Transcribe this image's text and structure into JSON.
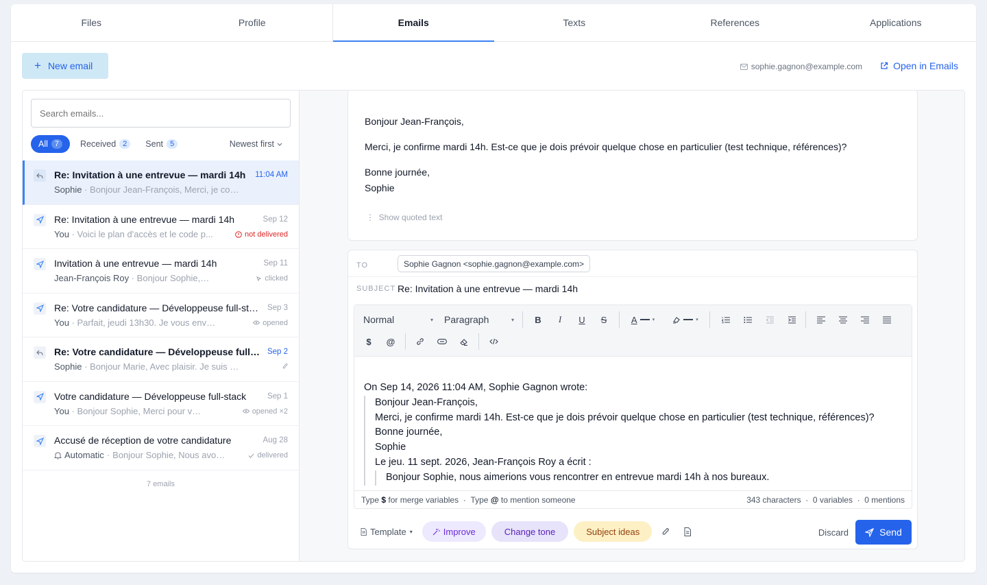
{
  "tabs": [
    "Files",
    "Profile",
    "Emails",
    "Texts",
    "References",
    "Applications"
  ],
  "toolbar": {
    "new_email": "New email",
    "account": "sophie.gagnon@example.com",
    "open_in": "Open in Emails"
  },
  "search": {
    "placeholder": "Search emails..."
  },
  "filters": {
    "all": "All",
    "all_count": "7",
    "received": "Received",
    "received_count": "2",
    "sent": "Sent",
    "sent_count": "5",
    "sort": "Newest first"
  },
  "emails": [
    {
      "subject": "Re: Invitation à une entrevue — mardi 14h",
      "date": "11:04 AM",
      "who": "Sophie",
      "preview": "Bonjour Jean-François, Merci, je confirme m...",
      "status": ""
    },
    {
      "subject": "Re: Invitation à une entrevue — mardi 14h",
      "date": "Sep 12",
      "who": "You",
      "preview": "Voici le plan d'accès et le code p...",
      "status": "not delivered"
    },
    {
      "subject": "Invitation à une entrevue — mardi 14h",
      "date": "Sep 11",
      "who": "Jean-François Roy",
      "preview": "Bonjour Sophie, Suite ...",
      "status": "clicked"
    },
    {
      "subject": "Re: Votre candidature — Développeuse full-stack",
      "date": "Sep 3",
      "who": "You",
      "preview": "Parfait, jeudi 13h30. Je vous envoie l'i...",
      "status": "opened"
    },
    {
      "subject": "Re: Votre candidature — Développeuse full-stack",
      "date": "Sep 2",
      "who": "Sophie",
      "preview": "Bonjour Marie, Avec plaisir. Je suis dispo...",
      "status": ""
    },
    {
      "subject": "Votre candidature — Développeuse full-stack",
      "date": "Sep 1",
      "who": "You",
      "preview": "Bonjour Sophie, Merci pour votre c...",
      "status": "opened ×2"
    },
    {
      "subject": "Accusé de réception de votre candidature",
      "date": "Aug 28",
      "who": "Automatic",
      "preview": "Bonjour Sophie, Nous avon...",
      "status": "delivered"
    }
  ],
  "email_count": "7 emails",
  "message": {
    "greeting": "Bonjour Jean-François,",
    "body": "Merci, je confirme mardi 14h. Est-ce que je dois prévoir quelque chose en particulier (test technique, références)?",
    "closing": "Bonne journée,",
    "signature": "Sophie",
    "show_quoted": "Show quoted text"
  },
  "compose": {
    "to_label": "TO",
    "to": "Sophie Gagnon <sophie.gagnon@example.com>",
    "subject_label": "SUBJECT",
    "subject": "Re: Invitation à une entrevue — mardi 14h",
    "style": "Normal",
    "block": "Paragraph",
    "quote_header": "On Sep 14, 2026 11:04 AM, Sophie Gagnon wrote:",
    "quote_lines": [
      "Bonjour Jean-François,",
      "Merci, je confirme mardi 14h. Est-ce que je dois prévoir quelque chose en particulier (test technique, références)?",
      "Bonne journée,",
      "Sophie",
      "Le jeu. 11 sept. 2026, Jean-François Roy a écrit :"
    ],
    "nested_quote": "Bonjour Sophie, nous aimerions vous rencontrer en entrevue mardi 14h à nos bureaux.",
    "hint_type1": "Type",
    "hint_merge": "for merge variables",
    "hint_type2": "Type",
    "hint_mention": "to mention someone",
    "chars": "343 characters",
    "vars": "0 variables",
    "mentions": "0 mentions",
    "template": "Template",
    "improve": "Improve",
    "tone": "Change tone",
    "subject_ideas": "Subject ideas",
    "discard": "Discard",
    "send": "Send"
  },
  "colors": {
    "accent": "#2563eb",
    "improve_bg": "#ede9fe",
    "tone_bg": "#e6e3fb",
    "ideas_bg": "#fdf0c4"
  }
}
